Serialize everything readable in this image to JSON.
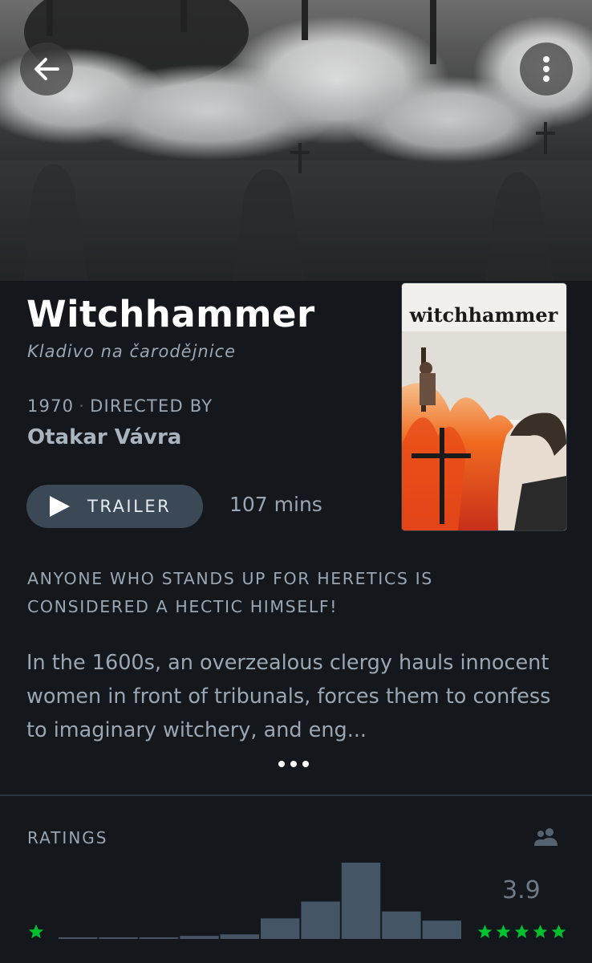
{
  "film": {
    "title": "Witchhammer",
    "original_title": "Kladivo na čarodějnice",
    "year": "1970",
    "directed_by_label": "DIRECTED BY",
    "director": "Otakar Vávra",
    "runtime": "107 mins",
    "tagline": "ANYONE WHO STANDS UP FOR HERETICS IS CONSIDERED A HECTIC HIMSELF!",
    "synopsis": "In the 1600s, an overzealous clergy hauls innocent women in front of tribunals, forces them to confess to imaginary witchery, and eng..."
  },
  "poster": {
    "title_text": "witchhammer"
  },
  "actions": {
    "trailer_label": "TRAILER",
    "back_icon": "arrow-left-icon",
    "more_icon": "more-vertical-icon",
    "expand_icon": "ellipsis-icon"
  },
  "ratings": {
    "label": "RATINGS",
    "average": "3.9",
    "fans_icon": "people-icon",
    "histogram": [
      0.01,
      0.01,
      0.01,
      0.04,
      0.06,
      0.27,
      0.49,
      1.0,
      0.36,
      0.24
    ],
    "low_stars": "★",
    "high_stars": "★★★★★"
  },
  "colors": {
    "background": "#14181c",
    "accent_green": "#00c030",
    "bar": "#456",
    "text_muted": "#9aa6b2",
    "button": "#3b4856"
  }
}
